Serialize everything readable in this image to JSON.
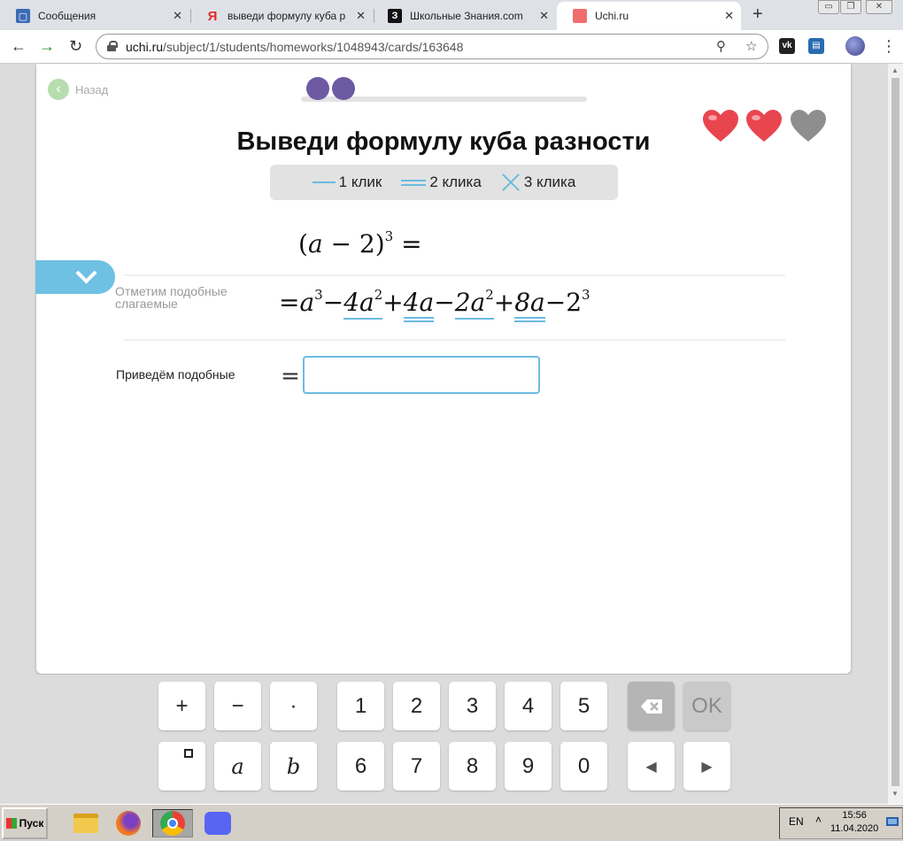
{
  "browser": {
    "tabs": [
      {
        "label": "Сообщения",
        "icon": "chat-icon",
        "active": false
      },
      {
        "label": "выведи формулу куба р",
        "icon": "yandex-icon",
        "active": false
      },
      {
        "label": "Школьные Знания.com",
        "icon": "znania-icon",
        "active": false
      },
      {
        "label": "Uchi.ru",
        "icon": "uchi-icon",
        "active": true
      }
    ],
    "url_domain": "uchi.ru",
    "url_path": "/subject/1/students/homeworks/1048943/cards/163648"
  },
  "page": {
    "back_label": "Назад",
    "title": "Выведи формулу куба разности",
    "progress_dots": 2,
    "hearts": [
      {
        "state": "full",
        "color": "#e8454f"
      },
      {
        "state": "full",
        "color": "#e8454f"
      },
      {
        "state": "empty",
        "color": "#8e8e8e"
      }
    ],
    "legend": [
      {
        "label": "1 клик",
        "icon": "single-line-icon"
      },
      {
        "label": "2 клика",
        "icon": "double-line-icon"
      },
      {
        "label": "3 клика",
        "icon": "cross-icon"
      }
    ],
    "equation_1": {
      "lhs_open": "(",
      "var": "a",
      "rest": " − 2)",
      "exp": "3",
      "eq": " ="
    },
    "step_label": "Отметим подобные слагаемые",
    "equation_2": {
      "terms": [
        {
          "text": "= ",
          "base": "a",
          "exp": "3",
          "underline": "none"
        },
        {
          "text": " − ",
          "base": "4a",
          "exp": "2",
          "underline": "single"
        },
        {
          "text": " + ",
          "base": "4a",
          "exp": "",
          "underline": "double"
        },
        {
          "text": " − ",
          "base": "2a",
          "exp": "2",
          "underline": "single"
        },
        {
          "text": " + ",
          "base": "8a",
          "exp": "",
          "underline": "double"
        },
        {
          "text": " − ",
          "base": "2",
          "exp": "3",
          "underline": "none"
        }
      ]
    },
    "reduce_label": "Приведём подобные",
    "reduce_eq": "=",
    "answer_value": ""
  },
  "keyboard": {
    "row1": [
      "+",
      "−",
      "·",
      "1",
      "2",
      "3",
      "4",
      "5"
    ],
    "row2_vars": [
      "a",
      "b"
    ],
    "row2_nums": [
      "6",
      "7",
      "8",
      "9",
      "0"
    ],
    "ok_label": "OK",
    "left_arrow": "◀",
    "right_arrow": "▶"
  },
  "taskbar": {
    "start_label": "Пуск",
    "lang": "EN",
    "time": "15:56",
    "date": "11.04.2020"
  },
  "colors": {
    "accent_blue": "#6bbbe0",
    "progress_purple": "#6d5aa2",
    "back_green": "#b7dcae"
  }
}
